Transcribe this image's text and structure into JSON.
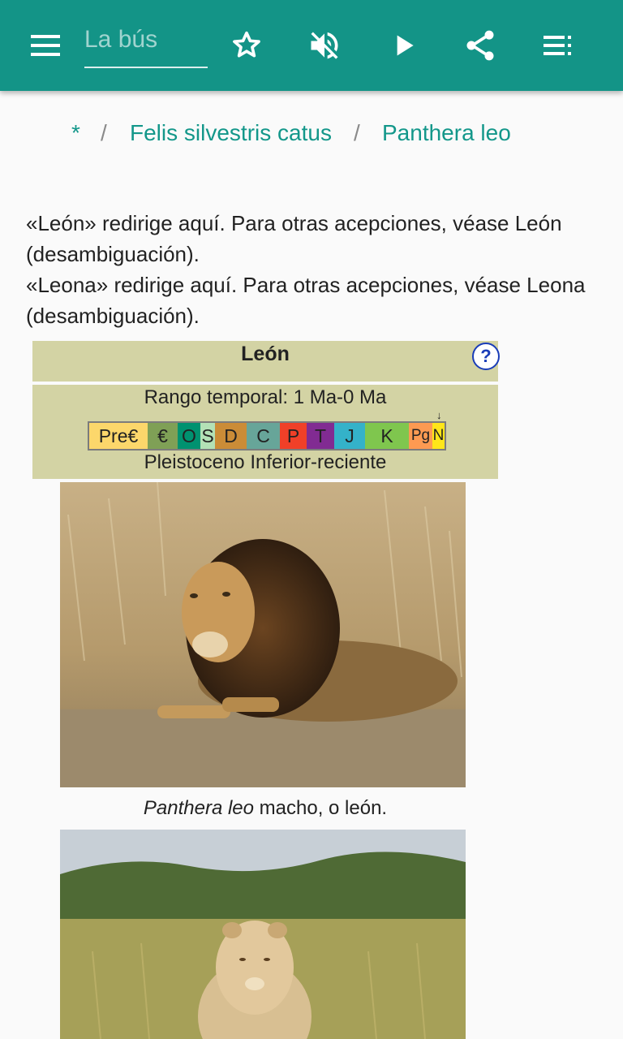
{
  "toolbar": {
    "search_placeholder": "La bús",
    "menu_icon": "hamburger-menu-icon",
    "star_icon": "star-outline-icon",
    "mute_icon": "volume-off-icon",
    "play_icon": "play-icon",
    "share_icon": "share-icon",
    "list_icon": "playlist-icon",
    "color": "#139487"
  },
  "breadcrumb": {
    "items": [
      "*",
      "Felis silvestris catus",
      "Panthera leo"
    ],
    "separator": "/"
  },
  "article": {
    "para1": "«León» redirige aquí. Para otras acepciones, véase León (desambiguación).",
    "para2": "«Leona» redirige aquí. Para otras acepciones, véase Leona (desambiguación)."
  },
  "taxobox": {
    "title": "León",
    "help_glyph": "?",
    "range_label": "Rango temporal: 1 Ma-0 Ma",
    "epoch": "Pleistoceno Inferior-reciente",
    "marker": "↓",
    "periods": [
      {
        "label": "Pre€",
        "color": "#fcd76b"
      },
      {
        "label": "€",
        "color": "#7fa056"
      },
      {
        "label": "O",
        "color": "#009270"
      },
      {
        "label": "S",
        "color": "#b3e1b6"
      },
      {
        "label": "D",
        "color": "#cb8c37"
      },
      {
        "label": "C",
        "color": "#67a599"
      },
      {
        "label": "P",
        "color": "#f04028"
      },
      {
        "label": "T",
        "color": "#812b92"
      },
      {
        "label": "J",
        "color": "#34b2c9"
      },
      {
        "label": "K",
        "color": "#7fc64e"
      },
      {
        "label": "Pg",
        "color": "#fd9a52"
      },
      {
        "label": "N",
        "color": "#ffe619"
      }
    ]
  },
  "images": {
    "lion_caption_italic": "Panthera leo",
    "lion_caption_rest": " macho, o león."
  }
}
